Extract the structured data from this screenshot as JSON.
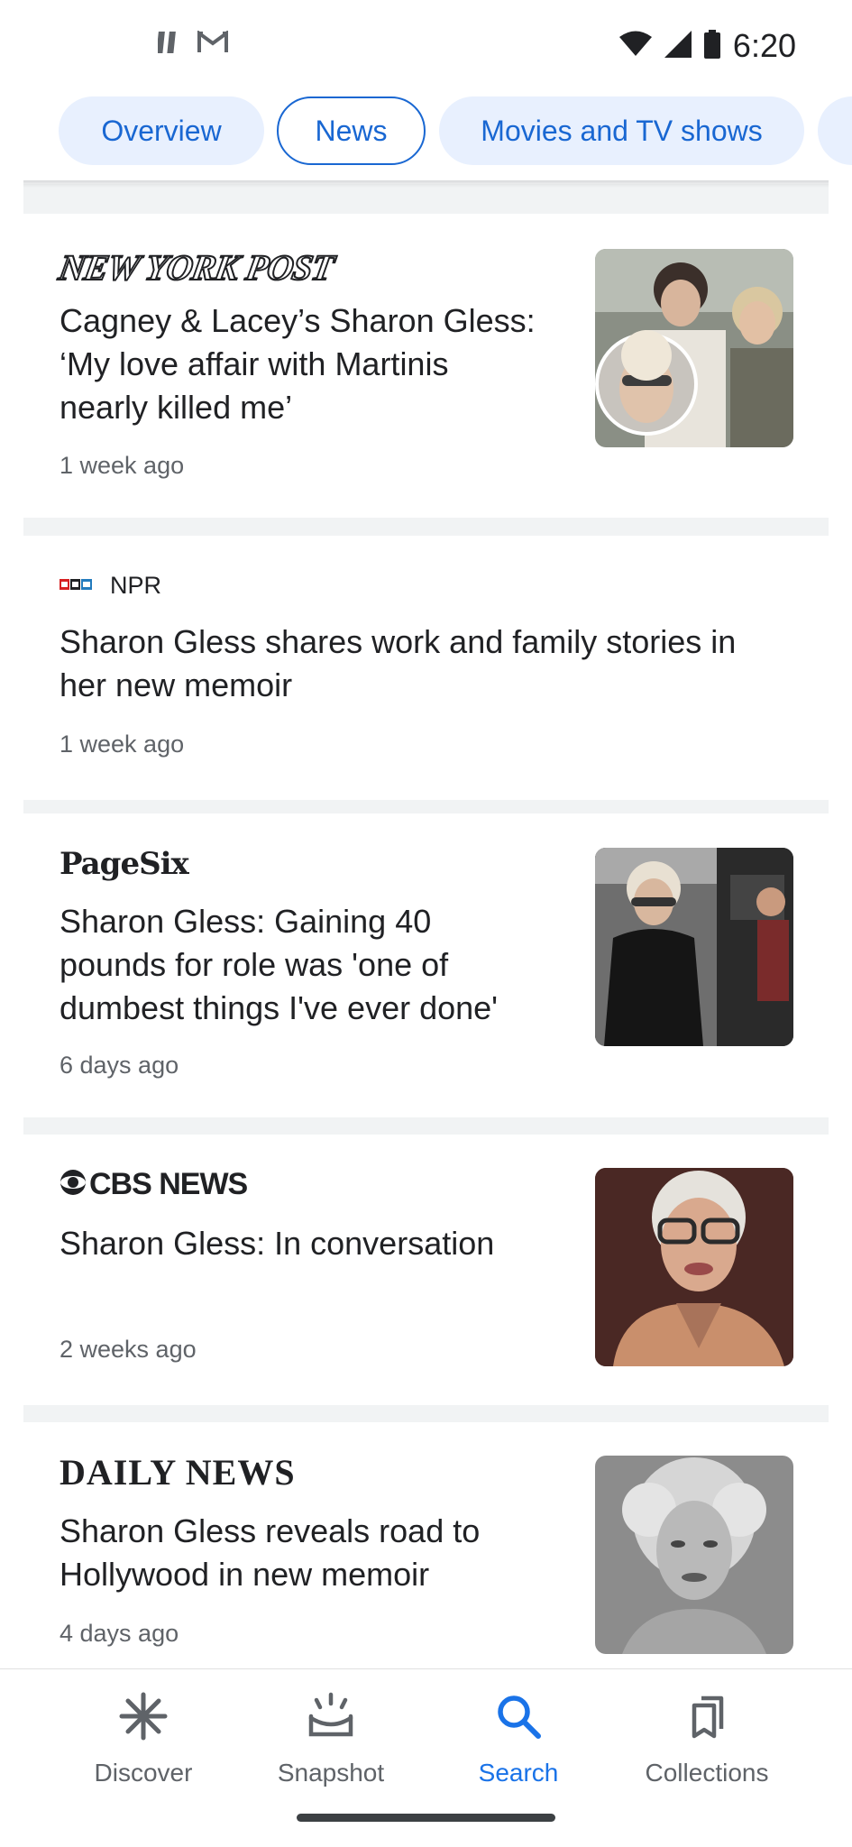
{
  "status_bar": {
    "time": "6:20",
    "left_icons": [
      "pause-icon",
      "gmail-icon"
    ],
    "right_icons": [
      "wifi-icon",
      "signal-icon",
      "battery-icon"
    ]
  },
  "chips": [
    {
      "label": "Overview",
      "active": false
    },
    {
      "label": "News",
      "active": true
    },
    {
      "label": "Movies and TV shows",
      "active": false
    }
  ],
  "articles": [
    {
      "source": "NEW YORK POST",
      "headline_lines": [
        "Cagney & Lacey’s Sharon Gless:",
        "‘My love affair with Martinis",
        "nearly killed me’"
      ],
      "time": "1 week ago",
      "has_thumbnail": true
    },
    {
      "source": "NPR",
      "headline_lines": [
        "Sharon Gless shares work and family stories in",
        "her new memoir"
      ],
      "time": "1 week ago",
      "has_thumbnail": false
    },
    {
      "source": "PageSix",
      "headline_lines": [
        "Sharon Gless: Gaining 40",
        "pounds for role was 'one of",
        "dumbest things I've ever done'"
      ],
      "time": "6 days ago",
      "has_thumbnail": true
    },
    {
      "source": "CBS NEWS",
      "headline_lines": [
        "Sharon Gless: In conversation"
      ],
      "time": "2 weeks ago",
      "has_thumbnail": true
    },
    {
      "source": "DAILY NEWS",
      "headline_lines": [
        "Sharon Gless reveals road to",
        "Hollywood in new memoir"
      ],
      "time": "4 days ago",
      "has_thumbnail": true
    }
  ],
  "bottom_nav": [
    {
      "label": "Discover",
      "icon": "asterisk-icon",
      "active": false
    },
    {
      "label": "Snapshot",
      "icon": "snapshot-icon",
      "active": false
    },
    {
      "label": "Search",
      "icon": "search-icon",
      "active": true
    },
    {
      "label": "Collections",
      "icon": "collections-icon",
      "active": false
    }
  ],
  "colors": {
    "accent": "#1a73e8",
    "chip_bg": "#e8f0fe",
    "chip_text": "#1967d2",
    "secondary_text": "#5f6368",
    "divider": "#f1f3f4"
  }
}
